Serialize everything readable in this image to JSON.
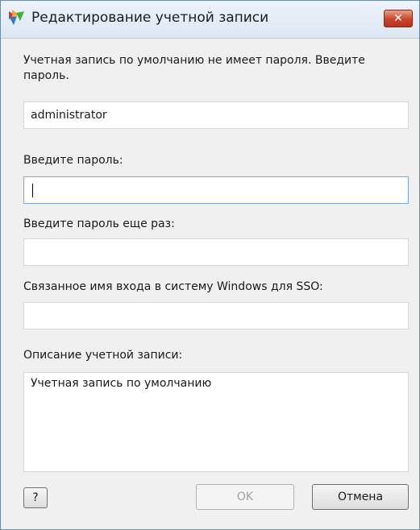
{
  "window": {
    "title": "Редактирование учетной записи",
    "close_label": "✕"
  },
  "message": "Учетная запись по умолчанию не имеет пароля. Введите пароль.",
  "account_name": {
    "value": "administrator"
  },
  "password": {
    "label": "Введите пароль:",
    "value": ""
  },
  "password_repeat": {
    "label": "Введите пароль еще раз:",
    "value": ""
  },
  "windows_login": {
    "label": "Связанное имя входа в систему Windows для SSO:",
    "value": ""
  },
  "description": {
    "label": "Описание учетной записи:",
    "value": "Учетная запись по умолчанию"
  },
  "buttons": {
    "help": "?",
    "ok": "OK",
    "cancel": "Отмена"
  },
  "colors": {
    "accent": "#7aa7d9",
    "close": "#c9452a",
    "background": "#f0f0f0"
  },
  "icons": {
    "app": "avg-logo-icon",
    "close": "close-icon"
  }
}
